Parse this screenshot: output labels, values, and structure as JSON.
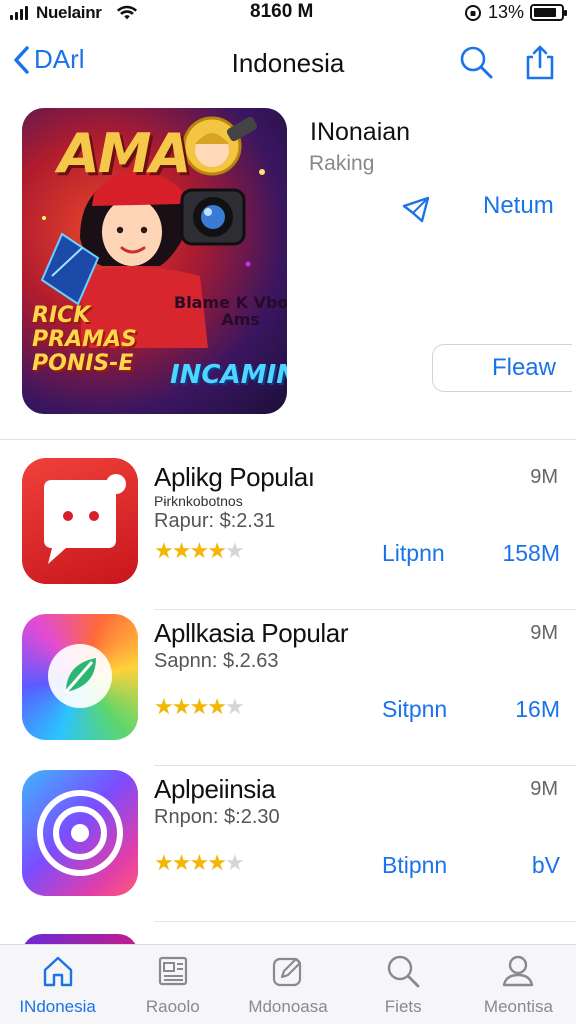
{
  "status_bar": {
    "carrier": "Nuelainr",
    "time": "8160 M",
    "battery_pct": "13%",
    "battery_level": 0.85
  },
  "nav": {
    "back_label": "DArl",
    "title": "Indonesia"
  },
  "featured": {
    "art_big_text": "AMA",
    "art_left_text": "RICK\nPRAMAS\nPONIS-E",
    "art_mid_text": "Blame K Vboro\nAms",
    "art_bottom_text": "INCAMING",
    "title": "INonaian",
    "subtitle": "Raking",
    "action_label": "Netum",
    "button_label": "Fleaw"
  },
  "apps": [
    {
      "name": "Aplikg Populaı",
      "tagline": "Pɨrknkobotnos",
      "price": "Rapur: $:2.31",
      "rating": 4,
      "size": "9M",
      "action_label": "Litpnn",
      "count": "158M"
    },
    {
      "name": "Apllkasia Popular",
      "tagline": "",
      "price": "Sapnn: $.2.63",
      "rating": 4,
      "size": "9M",
      "action_label": "Sitpnn",
      "count": "16M"
    },
    {
      "name": "Aplpeiinsia",
      "tagline": "",
      "price": "Rnpon: $:2.30",
      "rating": 4,
      "size": "9M",
      "action_label": "Btipnn",
      "count": "bV"
    }
  ],
  "tabs": [
    {
      "label": "INdonesia",
      "icon": "home-icon",
      "active": true
    },
    {
      "label": "Raoolo",
      "icon": "apps-icon",
      "active": false
    },
    {
      "label": "Mdonoasa",
      "icon": "compose-icon",
      "active": false
    },
    {
      "label": "Fiets",
      "icon": "search-icon",
      "active": false
    },
    {
      "label": "Meontisa",
      "icon": "profile-icon",
      "active": false
    }
  ],
  "colors": {
    "accent": "#1a73e8",
    "star": "#f2b705"
  }
}
